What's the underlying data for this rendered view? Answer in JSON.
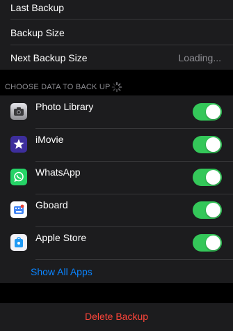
{
  "backup_info": {
    "last_backup_label": "Last Backup",
    "backup_size_label": "Backup Size",
    "next_backup_size_label": "Next Backup Size",
    "next_backup_size_value": "Loading..."
  },
  "section": {
    "header": "CHOOSE DATA TO BACK UP"
  },
  "apps": [
    {
      "name": "Photo Library",
      "icon": "camera-icon",
      "enabled": true
    },
    {
      "name": "iMovie",
      "icon": "imovie-star-icon",
      "enabled": true
    },
    {
      "name": "WhatsApp",
      "icon": "whatsapp-icon",
      "enabled": true
    },
    {
      "name": "Gboard",
      "icon": "gboard-icon",
      "enabled": true
    },
    {
      "name": "Apple Store",
      "icon": "apple-store-icon",
      "enabled": true
    }
  ],
  "show_all_apps": "Show All Apps",
  "delete_backup": "Delete Backup",
  "colors": {
    "background": "#000000",
    "group": "#1c1c1e",
    "toggle_on": "#34c759",
    "link": "#0a84ff",
    "destructive": "#ff453a",
    "secondary_text": "#8e8e93"
  }
}
